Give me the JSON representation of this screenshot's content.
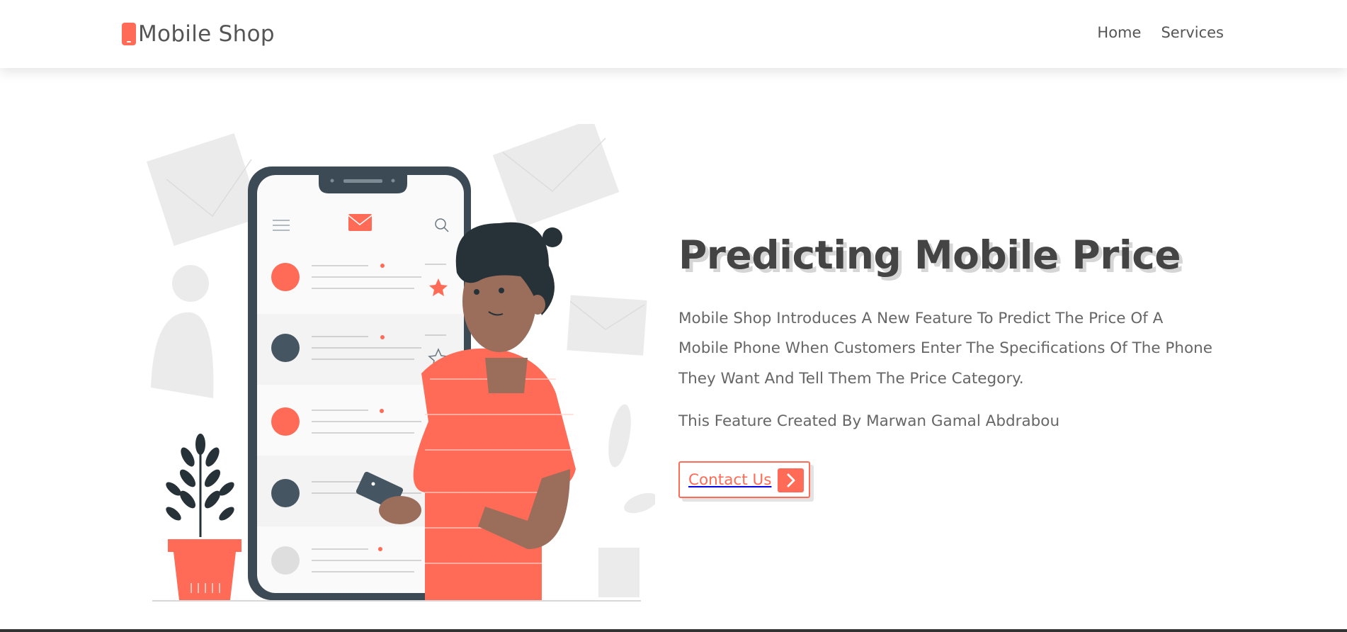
{
  "brand": {
    "name": "Mobile Shop",
    "accent": "#ff6b57"
  },
  "nav": {
    "items": [
      {
        "label": "Home"
      },
      {
        "label": "Services"
      }
    ]
  },
  "hero": {
    "title": "Predicting Mobile Price",
    "description": "Mobile Shop Introduces A New Feature To Predict The Price Of A Mobile Phone When Customers Enter The Specifications Of The Phone They Want And Tell Them The Price Category.",
    "credit": "This Feature Created By Marwan Gamal Abdrabou",
    "cta": {
      "label": "Contact Us",
      "icon": "chevron-right-icon"
    }
  },
  "icons": {
    "logo": "phone-icon",
    "illustration": "person-with-phone-illustration"
  }
}
